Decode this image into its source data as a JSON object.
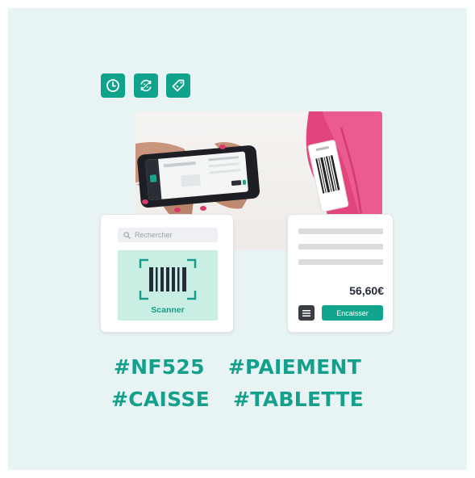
{
  "toolbar": {
    "icons": [
      "clock-icon",
      "refresh-percent-icon",
      "tag-icon"
    ]
  },
  "search": {
    "placeholder": "Rechercher"
  },
  "scanner": {
    "label": "Scanner"
  },
  "checkout": {
    "amount": "56,60€",
    "pay_label": "Encaisser"
  },
  "hashtags": {
    "row1": [
      "#NF525",
      "#PAIEMENT"
    ],
    "row2": [
      "#CAISSE",
      "#TABLETTE"
    ]
  },
  "colors": {
    "accent": "#0fa38c",
    "background": "#e8f3f4",
    "scanner_bg": "#c9efe4"
  }
}
